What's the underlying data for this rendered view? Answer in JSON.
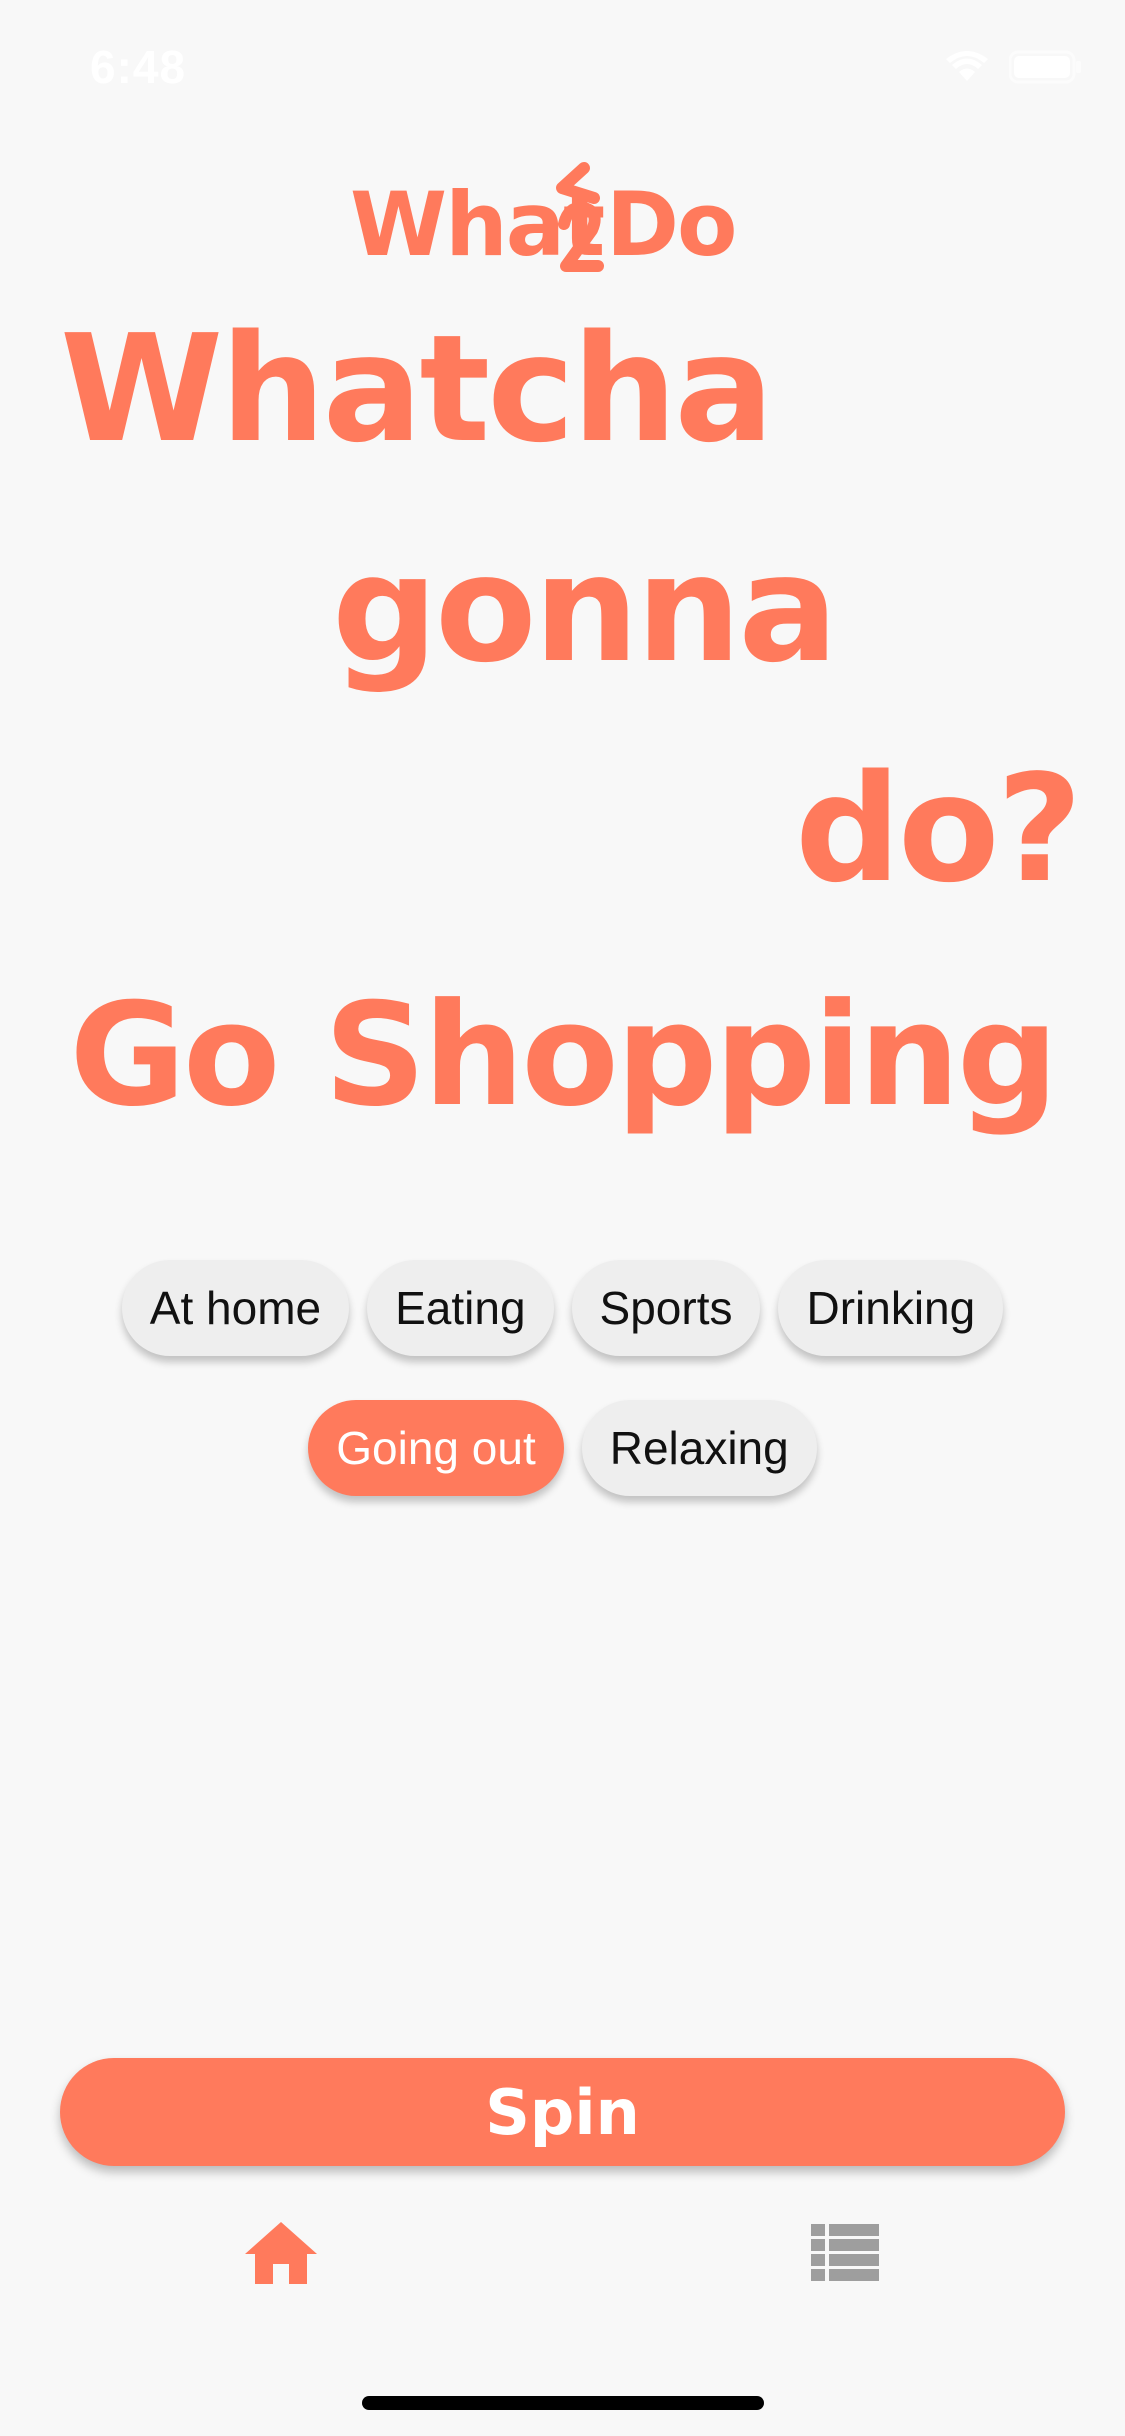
{
  "status_bar": {
    "time": "6:48"
  },
  "app": {
    "logo_text": "What2Do",
    "accent_color": "#ff7a5c"
  },
  "headline": {
    "line1": "Whatcha",
    "line2": "gonna",
    "line3": "do?"
  },
  "result": {
    "text": "Go Shopping"
  },
  "categories": [
    {
      "label": "At home",
      "selected": false
    },
    {
      "label": "Eating",
      "selected": false
    },
    {
      "label": "Sports",
      "selected": false
    },
    {
      "label": "Drinking",
      "selected": false
    },
    {
      "label": "Going out",
      "selected": true
    },
    {
      "label": "Relaxing",
      "selected": false
    }
  ],
  "spin_button": {
    "label": "Spin"
  },
  "tab_bar": {
    "tabs": [
      {
        "icon": "home-icon",
        "active": true
      },
      {
        "icon": "list-icon",
        "active": false
      }
    ]
  }
}
